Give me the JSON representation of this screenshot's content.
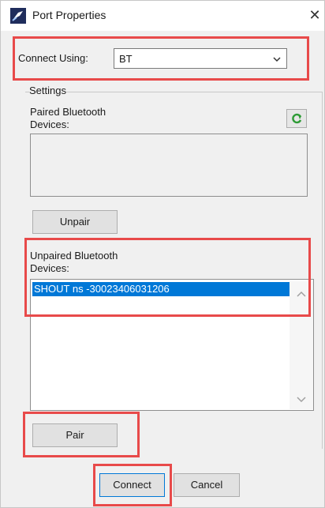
{
  "window": {
    "title": "Port Properties",
    "close_glyph": "✕",
    "icon": "port-app-icon"
  },
  "connect": {
    "label": "Connect Using:",
    "value": "BT"
  },
  "settings": {
    "group_label": "Settings",
    "paired_label_line1": "Paired Bluetooth",
    "paired_label_line2": "Devices:",
    "refresh_icon": "refresh-icon",
    "paired_devices": [],
    "unpair_label": "Unpair",
    "unpaired_label_line1": "Unpaired Bluetooth",
    "unpaired_label_line2": "Devices:",
    "unpaired_devices": [
      {
        "name": "SHOUT ns -30023406031206",
        "selected": true
      }
    ],
    "pair_label": "Pair"
  },
  "footer": {
    "connect_label": "Connect",
    "cancel_label": "Cancel"
  },
  "colors": {
    "highlight": "#e84a4a",
    "selection": "#0078d7",
    "window_bg": "#f0f0f0"
  }
}
